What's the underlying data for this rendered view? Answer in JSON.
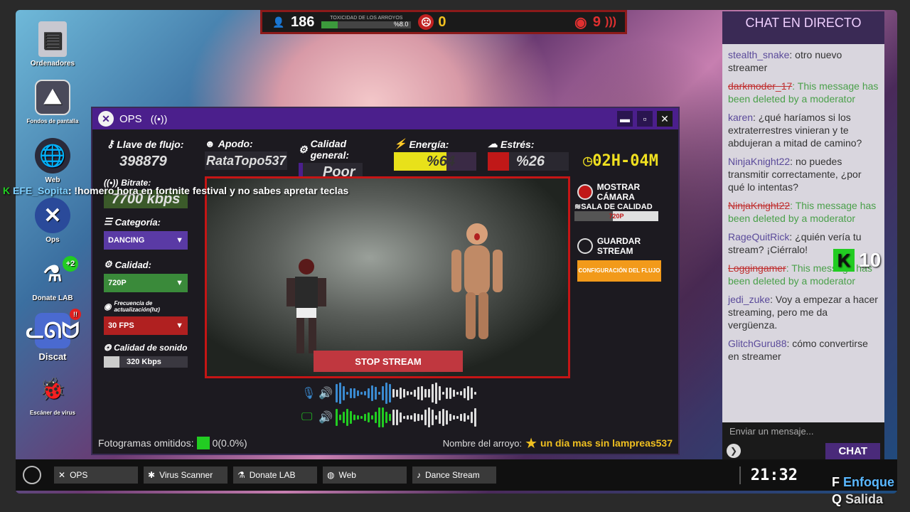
{
  "hud": {
    "viewers": "186",
    "toxicity_label": "TOXICIDAD DE LOS ARROYOS",
    "toxicity_value": "%8.0",
    "toxicity_level": 0.08,
    "hate": "0",
    "alerts": "9"
  },
  "desktop": {
    "icons": [
      {
        "label": "Ordenadores"
      },
      {
        "label": "Fondos de pantalla"
      },
      {
        "label": "Web"
      },
      {
        "label": "Ops"
      },
      {
        "label": "Donate LAB",
        "badge": "+2"
      },
      {
        "label": "Discat",
        "badge": "!!"
      },
      {
        "label": "Escáner de virus"
      }
    ]
  },
  "window": {
    "title": "OPS",
    "stats": {
      "stream_key_label": "Llave de flujo:",
      "stream_key": "398879",
      "nick_label": "Apodo:",
      "nick": "RataTopo537",
      "quality_label": "Calidad general:",
      "quality": "Poor",
      "energy_label": "Energía:",
      "energy": "%64",
      "energy_level": 0.64,
      "stress_label": "Estrés:",
      "stress": "%26",
      "clock": "02H-04M",
      "bitrate_label": "Bitrate:",
      "bitrate": "7700 kbps"
    },
    "sidebar": {
      "category_label": "Categoría:",
      "category": "DANCING",
      "quality_label": "Calidad:",
      "quality": "720P",
      "refresh_label": "Frecuencia de actualización(hz)",
      "refresh": "30 FPS",
      "sound_label": "Calidad de sonido",
      "sound": "320 Kbps"
    },
    "controls": {
      "show_camera": "MOSTRAR CÁMARA",
      "quality_room": "SALA DE CALIDAD",
      "quality_room_value": "720P",
      "save_stream": "GUARDAR STREAM",
      "config": "CONFIGURACIÓN DEL FLUJO",
      "stop": "STOP STREAM"
    },
    "footer": {
      "dropped_label": "Fotogramas omitidos:",
      "dropped_value": "0(0.0%)",
      "stream_name_label": "Nombre del arroyo:",
      "stream_name": "un dia mas sin lampreas537"
    }
  },
  "overlay": {
    "user": "EFE_Sopita",
    "text": ": !homero hora en fortnite festival y no sabes apretar teclas"
  },
  "k_counter": "10",
  "chat": {
    "title": "CHAT EN DIRECTO",
    "messages": [
      {
        "user": "stealth_snake",
        "text": ": otro nuevo streamer",
        "deleted": false
      },
      {
        "user": "darkmoder_17",
        "text": ": This message has been deleted by a moderator",
        "deleted": true
      },
      {
        "user": "karen",
        "text": ": ¿qué haríamos si los extraterrestres vinieran y te abdujeran a mitad de camino?",
        "deleted": false
      },
      {
        "user": "NinjaKnight22",
        "text": ": no puedes transmitir correctamente, ¿por qué lo intentas?",
        "deleted": false
      },
      {
        "user": "NinjaKnight22",
        "text": ": This message has been deleted by a moderator",
        "deleted": true
      },
      {
        "user": "RageQuitRick",
        "text": ": ¿quién vería tu stream? ¡Ciérralo!",
        "deleted": false
      },
      {
        "user": "Loggingamer",
        "text": ": This message has been deleted by a moderator",
        "deleted": true
      },
      {
        "user": "jedi_zuke",
        "text": ": Voy a empezar a hacer streaming, pero me da vergüenza.",
        "deleted": false
      },
      {
        "user": "GlitchGuru88",
        "text": ": cómo convertirse en streamer",
        "deleted": false
      }
    ],
    "input_placeholder": "Enviar un mensaje...",
    "send": "CHAT"
  },
  "taskbar": {
    "items": [
      "OPS",
      "Virus Scanner",
      "Donate LAB",
      "Web",
      "Dance Stream"
    ],
    "clock": "21:32"
  },
  "hints": [
    {
      "key": "F",
      "label": "Enfoque"
    },
    {
      "key": "Q",
      "label": "Salida"
    }
  ]
}
